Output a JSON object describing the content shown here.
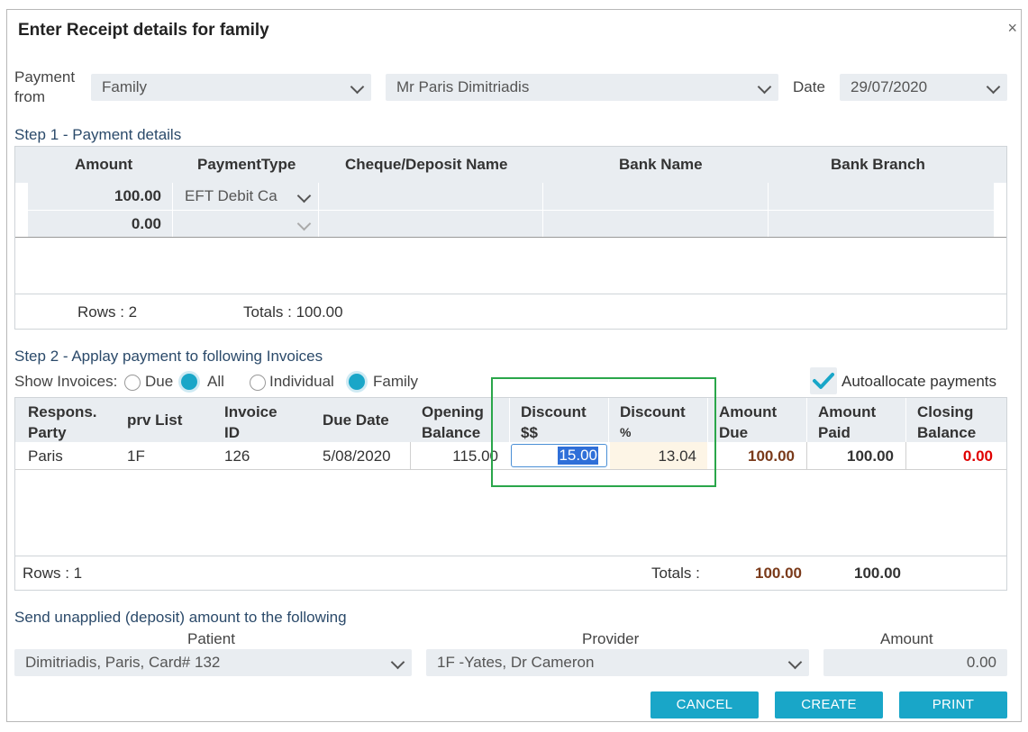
{
  "dialog": {
    "title": "Enter Receipt details for family",
    "close": "×"
  },
  "payment_from": {
    "label_line1": "Payment",
    "label_line2": "from",
    "type_value": "Family",
    "person_value": "Mr Paris  Dimitriadis",
    "date_label": "Date",
    "date_value": "29/07/2020"
  },
  "step1": {
    "label": "Step 1 - Payment details",
    "headers": [
      "Amount",
      "PaymentType",
      "Cheque/Deposit Name",
      "Bank Name",
      "Bank Branch"
    ],
    "rows": [
      {
        "amount": "100.00",
        "type": "EFT Debit Ca"
      },
      {
        "amount": "0.00",
        "type": ""
      }
    ],
    "rows_count": "Rows : 2",
    "totals": "Totals : 100.00"
  },
  "step2": {
    "label": "Step 2 - Applay payment to following Invoices",
    "show_invoices_label": "Show Invoices:",
    "radio_due": "Due",
    "radio_all": "All",
    "radio_individual": "Individual",
    "radio_family": "Family",
    "autoallocate": "Autoallocate payments",
    "headers": {
      "respons_1": "Respons.",
      "respons_2": "Party",
      "prv": "prv List",
      "inv_1": "Invoice",
      "inv_2": "ID",
      "due": "Due Date",
      "open_1": "Opening",
      "open_2": "Balance",
      "disc_1": "Discount",
      "disc_2": "$$",
      "discp_1": "Discount",
      "discp_2": "%",
      "amtdue_1": "Amount",
      "amtdue_2": "Due",
      "amtpaid_1": "Amount",
      "amtpaid_2": "Paid",
      "close_1": "Closing",
      "close_2": "Balance"
    },
    "row": {
      "party": "Paris",
      "prv": "1F",
      "invoice": "126",
      "due_date": "5/08/2020",
      "opening": "115.00",
      "discount": "15.00",
      "discount_pct": "13.04",
      "amount_due": "100.00",
      "amount_paid": "100.00",
      "closing": "0.00"
    },
    "rows_count": "Rows : 1",
    "totals_label": "Totals :",
    "total_due": "100.00",
    "total_paid": "100.00"
  },
  "unapplied": {
    "label": "Send unapplied (deposit) amount to the following",
    "patient_label": "Patient",
    "provider_label": "Provider",
    "amount_label": "Amount",
    "patient_value": "Dimitriadis, Paris, Card# 132",
    "provider_value": "1F -Yates, Dr Cameron",
    "amount_value": "0.00"
  },
  "buttons": {
    "cancel": "CANCEL",
    "create": "CREATE",
    "print": "PRINT"
  },
  "colors": {
    "accent": "#19a6c8",
    "amount_due": "#7a3a1a",
    "closing_zero": "#e00000",
    "highlight_box": "#2aa64a"
  }
}
